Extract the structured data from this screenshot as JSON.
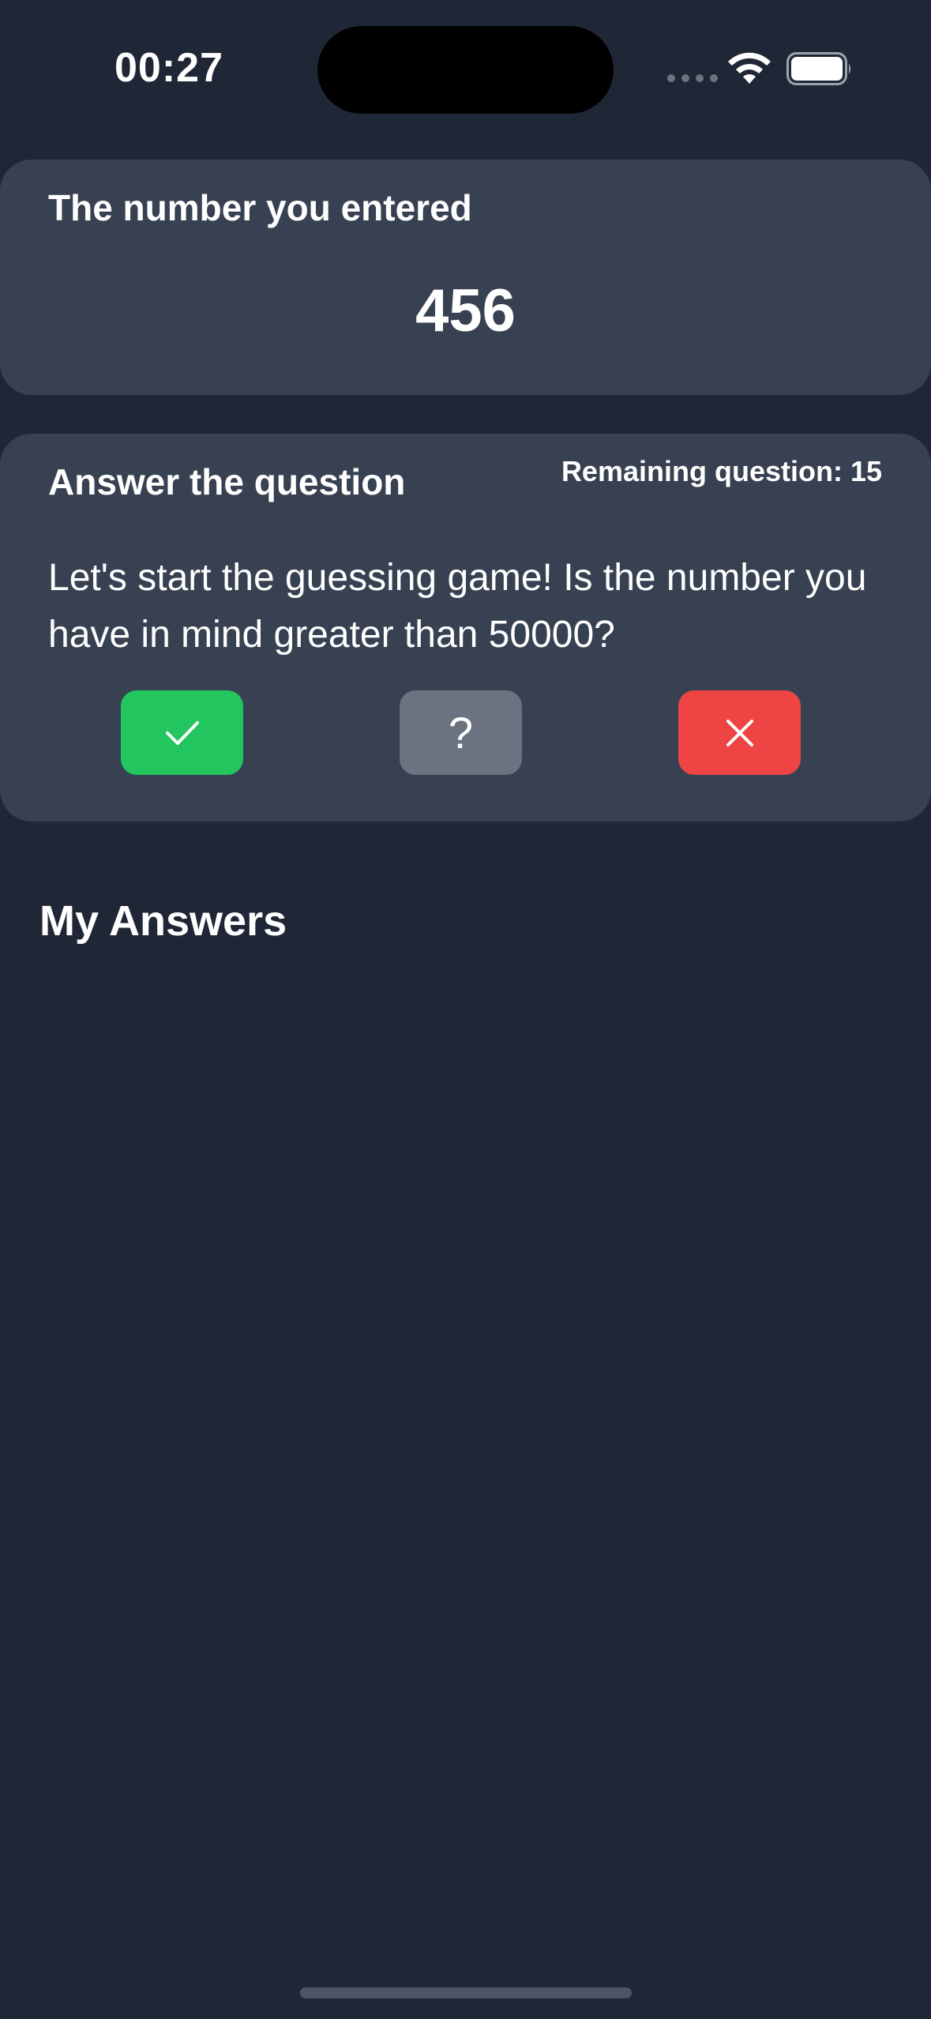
{
  "status_bar": {
    "time": "00:27",
    "icons": [
      "cellular-dots-icon",
      "wifi-icon",
      "battery-icon"
    ]
  },
  "entered_card": {
    "title": "The number you entered",
    "number": "456"
  },
  "question_card": {
    "title": "Answer the question",
    "remaining": "Remaining question: 15",
    "question": "Let's start the guessing game! Is the number you have in mind greater than 50000?",
    "buttons": {
      "yes_icon": "check-icon",
      "unknown_label": "?",
      "no_icon": "close-icon"
    }
  },
  "answers": {
    "title": "My Answers",
    "items": []
  },
  "colors": {
    "background": "#1f2736",
    "card": "#374151",
    "yes": "#22c55e",
    "unknown": "#6b7280",
    "no": "#ef4444"
  }
}
